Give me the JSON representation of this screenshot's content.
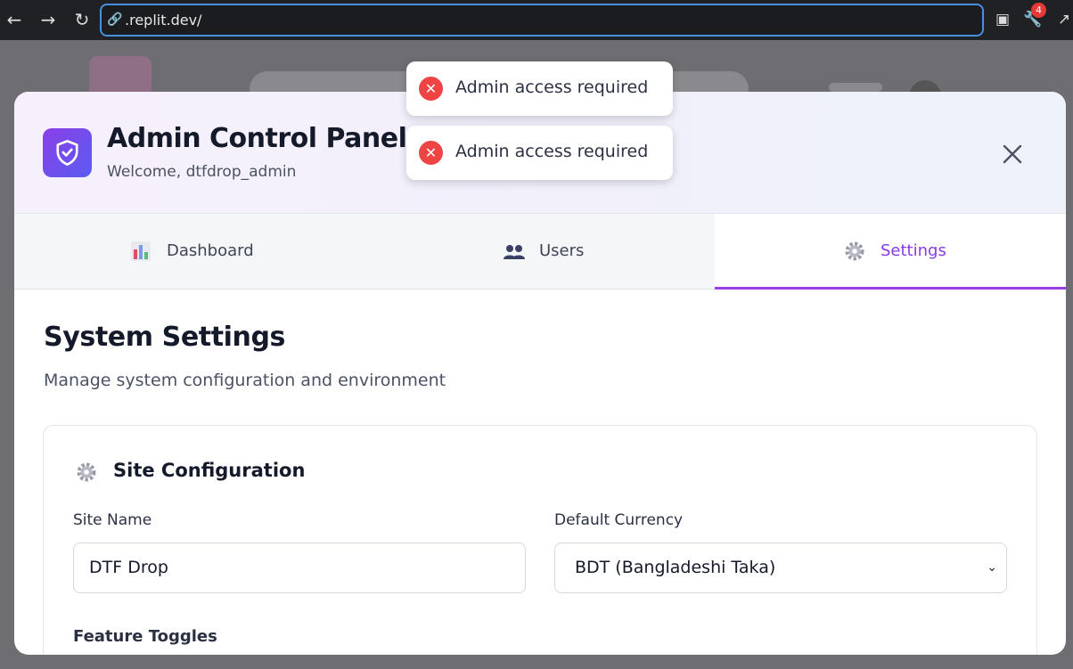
{
  "browser": {
    "url": ".replit.dev/",
    "notification_count": "4"
  },
  "modal": {
    "title": "Admin Control Panel",
    "welcome": "Welcome, dtfdrop_admin",
    "tabs": [
      {
        "label": "Dashboard",
        "icon": "bar-chart-icon",
        "active": false
      },
      {
        "label": "Users",
        "icon": "users-icon",
        "active": false
      },
      {
        "label": "Settings",
        "icon": "gear-icon",
        "active": true
      }
    ]
  },
  "settings": {
    "heading": "System Settings",
    "subheading": "Manage system configuration and environment",
    "site_config": {
      "title": "Site Configuration",
      "site_name_label": "Site Name",
      "site_name_value": "DTF Drop",
      "currency_label": "Default Currency",
      "currency_value": "BDT (Bangladeshi Taka)",
      "feature_toggles_label": "Feature Toggles"
    }
  },
  "toasts": [
    {
      "message": "Admin access required",
      "type": "error"
    },
    {
      "message": "Admin access required",
      "type": "error"
    }
  ],
  "colors": {
    "accent": "#8a3ae6",
    "error": "#ef4444",
    "url_focus": "#4a8fe0"
  }
}
